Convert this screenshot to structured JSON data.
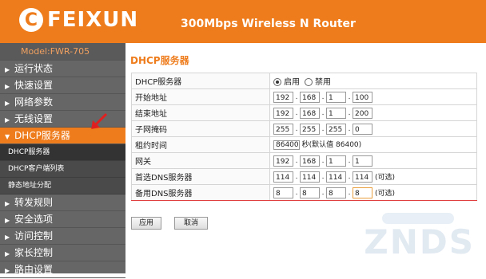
{
  "header": {
    "logo_mark": "C",
    "logo_text": "FEIXUN",
    "title": "300Mbps Wireless N Router"
  },
  "sidebar": {
    "model": "Model:FWR-705",
    "items_before": [
      "运行状态",
      "快速设置",
      "网络参数",
      "无线设置"
    ],
    "active": "DHCP服务器",
    "sub_items": [
      "DHCP服务器",
      "DHCP客户端列表",
      "静态地址分配"
    ],
    "items_after": [
      "转发规则",
      "安全选项",
      "访问控制",
      "家长控制",
      "路由设置"
    ]
  },
  "content": {
    "title": "DHCP服务器",
    "rows": [
      {
        "label": "DHCP服务器",
        "type": "radio",
        "options": [
          "启用",
          "禁用"
        ],
        "selected": "启用"
      },
      {
        "label": "开始地址",
        "type": "ip",
        "value": [
          "192",
          "168",
          "1",
          "100"
        ]
      },
      {
        "label": "结束地址",
        "type": "ip",
        "value": [
          "192",
          "168",
          "1",
          "200"
        ]
      },
      {
        "label": "子网掩码",
        "type": "ip",
        "value": [
          "255",
          "255",
          "255",
          "0"
        ]
      },
      {
        "label": "租约时间",
        "type": "text",
        "value": "86400",
        "note": "秒(默认值 86400)"
      },
      {
        "label": "网关",
        "type": "ip",
        "value": [
          "192",
          "168",
          "1",
          "1"
        ]
      },
      {
        "label": "首选DNS服务器",
        "type": "ip",
        "value": [
          "114",
          "114",
          "114",
          "114"
        ],
        "note": "(可选)"
      },
      {
        "label": "备用DNS服务器",
        "type": "ip",
        "value": [
          "8",
          "8",
          "8",
          "8"
        ],
        "note": "(可选)"
      }
    ],
    "buttons": {
      "apply": "应用",
      "cancel": "取消"
    }
  },
  "watermark": "ZNDS"
}
